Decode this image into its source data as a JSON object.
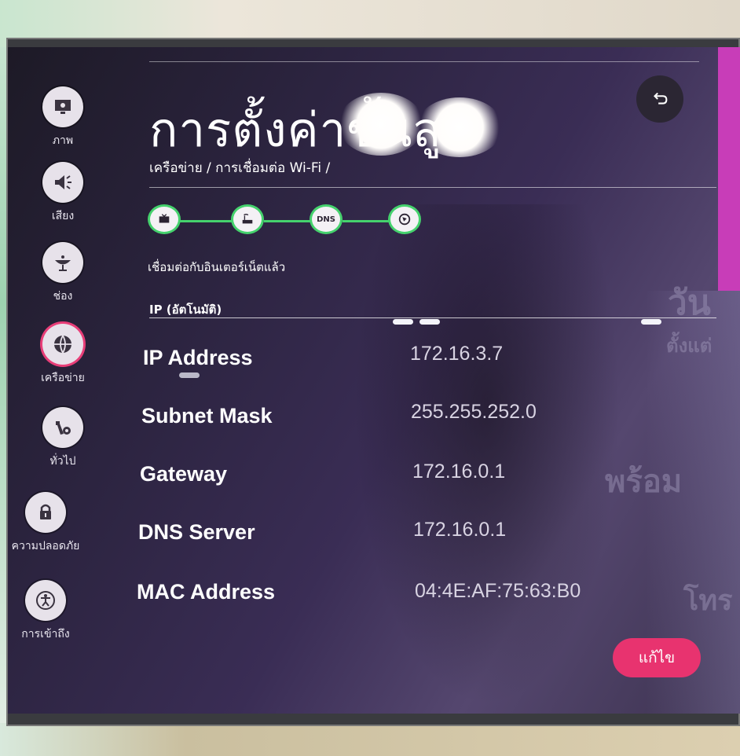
{
  "sidebar": {
    "items": [
      {
        "label": "ภาพ",
        "icon": "picture-icon",
        "active": false
      },
      {
        "label": "เสียง",
        "icon": "speaker-icon",
        "active": false
      },
      {
        "label": "ช่อง",
        "icon": "satellite-dish-icon",
        "active": false
      },
      {
        "label": "เครือข่าย",
        "icon": "globe-icon",
        "active": true
      },
      {
        "label": "ทั่วไป",
        "icon": "wrench-gear-icon",
        "active": false
      },
      {
        "label": "ความปลอดภัย",
        "icon": "lock-icon",
        "active": false
      },
      {
        "label": "การเข้าถึง",
        "icon": "accessibility-icon",
        "active": false
      }
    ]
  },
  "header": {
    "title": "การตั้งค่าขั้นสูง",
    "breadcrumb": "เครือข่าย / การเชื่อมต่อ Wi-Fi /",
    "back_icon": "back-arrow-icon"
  },
  "connection": {
    "steps": [
      {
        "name": "tv-icon",
        "label": ""
      },
      {
        "name": "router-icon",
        "label": ""
      },
      {
        "name": "dns-icon",
        "label": "DNS"
      },
      {
        "name": "internet-globe-icon",
        "label": ""
      }
    ],
    "status": "เชื่อมต่อกับอินเตอร์เน็ตแล้ว",
    "ip_mode": "IP (อัตโนมัติ)"
  },
  "network": {
    "rows": [
      {
        "label": "IP Address",
        "value": "172.16.3.7"
      },
      {
        "label": "Subnet Mask",
        "value": "255.255.252.0"
      },
      {
        "label": "Gateway",
        "value": "172.16.0.1"
      },
      {
        "label": "DNS Server",
        "value": "172.16.0.1"
      },
      {
        "label": "MAC Address",
        "value": "04:4E:AF:75:63:B0"
      }
    ]
  },
  "actions": {
    "edit_label": "แก้ไข"
  },
  "background_reflection": {
    "texts": [
      "วัน",
      "ตั้งแต่",
      "พร้อม",
      "โทร"
    ]
  },
  "colors": {
    "accent": "#e8336f",
    "connected": "#45d26d",
    "brand_bar": "#c83db8"
  }
}
